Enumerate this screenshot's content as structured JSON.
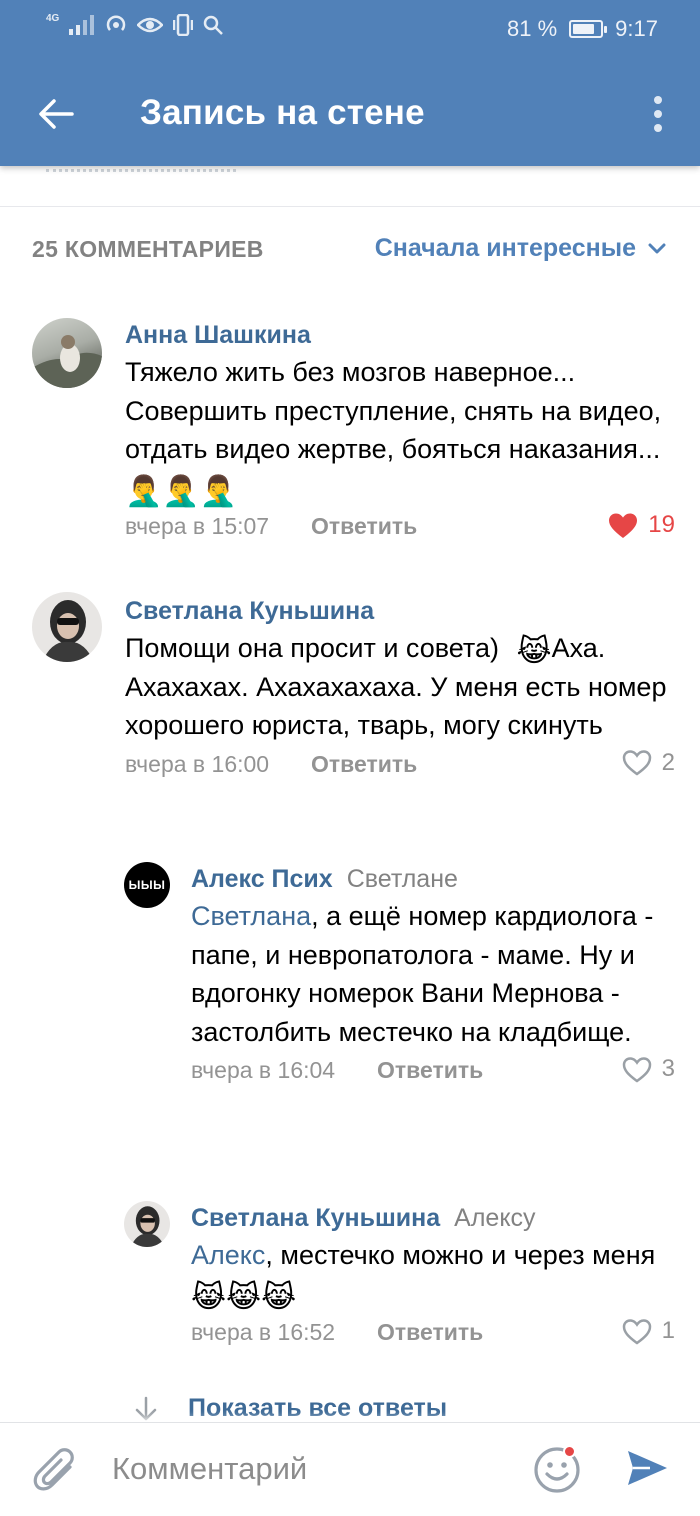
{
  "status_bar": {
    "network": "4G",
    "battery": "81 %",
    "battery_level": 0.81,
    "time": "9:17"
  },
  "header": {
    "title": "Запись на стене"
  },
  "comments_header": {
    "count": "25 КОММЕНТАРИЕВ",
    "sort": "Сначала интересные"
  },
  "comments": [
    {
      "author": "Анна Шашкина",
      "text": "Тяжело жить без мозгов наверное... Совершить преступление, снять на видео, отдать видео жертве, бояться наказания...",
      "emoji": "🤦‍♂️🤦‍♂️🤦‍♂️",
      "date": "вчера в 15:07",
      "reply_label": "Ответить",
      "likes": "19",
      "liked": true
    },
    {
      "author": "Светлана Куньшина",
      "text_before": "Помощи она просит и совета)",
      "emoji": "😹",
      "text_after": "Аха. Ахахахах. Ахахахахаха. У меня есть номер хорошего юриста, тварь, могу скинуть",
      "date": "вчера в 16:00",
      "reply_label": "Ответить",
      "likes": "2",
      "liked": false
    }
  ],
  "replies": [
    {
      "author": "Алекс Псих",
      "reply_to": "Светлане",
      "avatar_text": "ЫЫЫ",
      "mention": "Светлана",
      "text": ", а ещё номер кардиолога - папе, и невропатолога - маме. Ну и вдогонку номерок Вани Мернова - застолбить местечко на кладбище.",
      "date": "вчера в 16:04",
      "reply_label": "Ответить",
      "likes": "3"
    },
    {
      "author": "Светлана Куньшина",
      "reply_to": "Алексу",
      "mention": "Алекс",
      "text": ", местечко можно и через меня",
      "emoji": "😹😹😹",
      "date": "вчера в 16:52",
      "reply_label": "Ответить",
      "likes": "1"
    }
  ],
  "show_all_replies": "Показать все ответы",
  "composer": {
    "placeholder": "Комментарий"
  },
  "colors": {
    "header": "#5181b8",
    "link": "#3e6a96",
    "like": "#e64646",
    "muted": "#939393"
  },
  "icons": {
    "back": "back-arrow-icon",
    "menu": "more-vertical-icon",
    "sort": "chevron-down-icon",
    "heart": "heart-icon",
    "attach": "paperclip-icon",
    "emoji": "smile-icon",
    "send": "send-icon"
  }
}
